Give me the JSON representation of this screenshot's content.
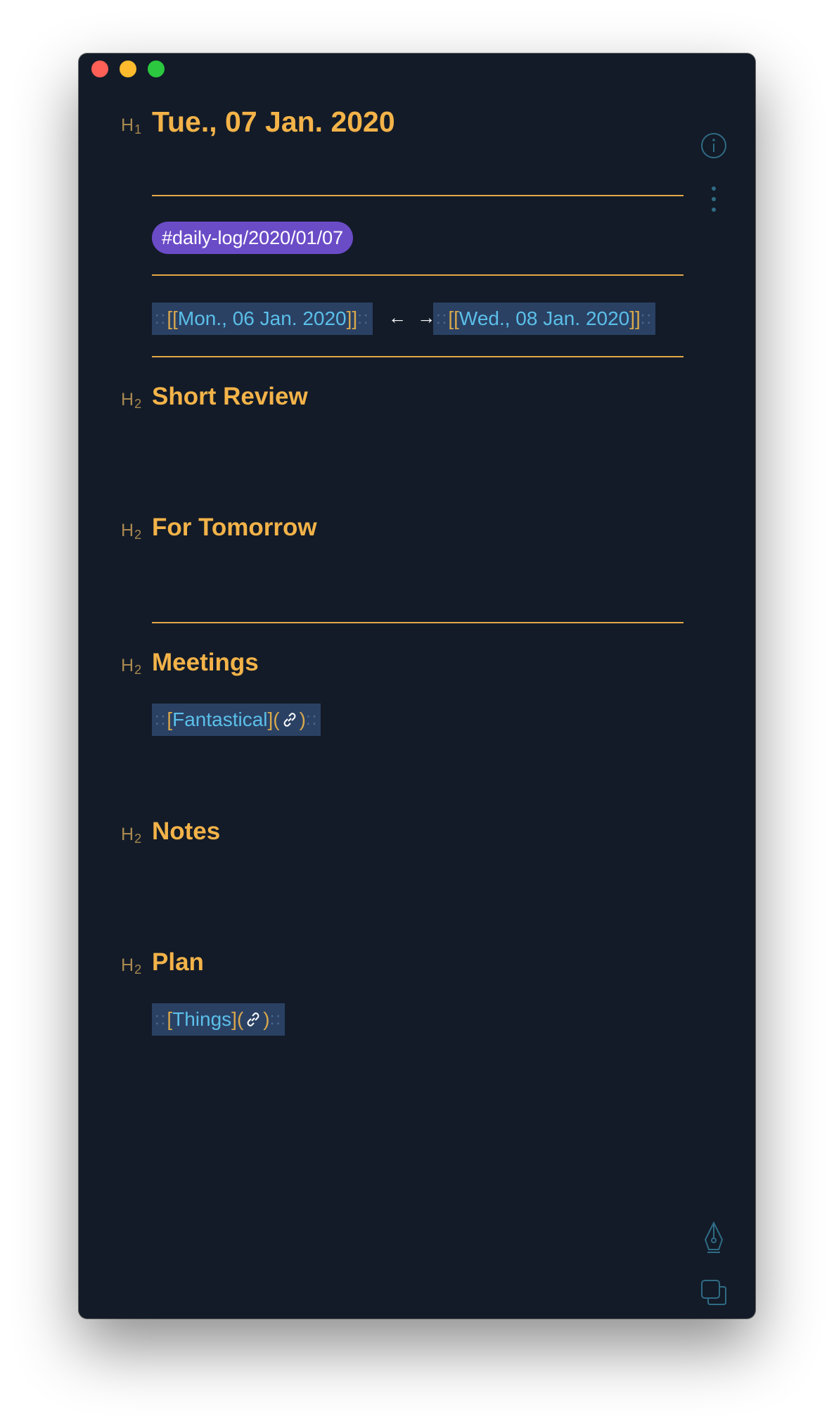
{
  "window": {
    "traffic_lights": {
      "close": "#fe5f57",
      "minimize": "#febb2e",
      "zoom": "#2bc840"
    }
  },
  "icons": {
    "info": "info-icon",
    "more": "more-vertical-icon",
    "pen": "pen-nib-icon",
    "duplicate": "copy-icon",
    "link": "chain-link-icon"
  },
  "colors": {
    "background": "#131b28",
    "heading": "#f3b349",
    "heading_marker": "#a9894f",
    "rule": "#e3a846",
    "tag_bg": "#6b4cc7",
    "link_bg": "#2a4164",
    "link_text": "#5bbfe8"
  },
  "doc": {
    "h1_marker": "H",
    "h1_level": "1",
    "title": "Tue., 07 Jan. 2020",
    "tag": "#daily-log/2020/01/07",
    "nav": {
      "prev_open": "[[",
      "prev_label": "Mon., 06 Jan. 2020",
      "prev_close": "]]",
      "arrows": "← →",
      "next_open": "[[",
      "next_label": "Wed., 08 Jan. 2020",
      "next_close": "]]",
      "dots": "::"
    },
    "h2_marker": "H",
    "h2_level": "2",
    "sections": {
      "short_review": "Short Review",
      "for_tomorrow": "For Tomorrow",
      "meetings": "Meetings",
      "notes": "Notes",
      "plan": "Plan"
    },
    "meetings_link": {
      "open": "[",
      "label": "Fantastical",
      "mid": "](",
      "close": ")"
    },
    "plan_link": {
      "open": "[",
      "label": "Things",
      "mid": "](",
      "close": ")"
    }
  }
}
